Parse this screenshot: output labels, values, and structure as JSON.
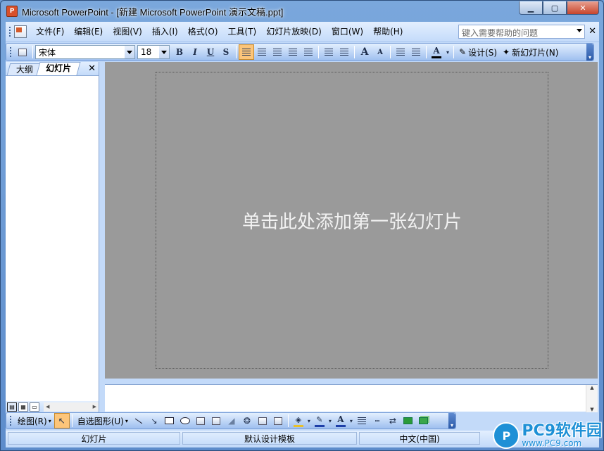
{
  "window": {
    "title": "Microsoft PowerPoint - [新建 Microsoft PowerPoint 演示文稿.ppt]",
    "app_icon_letter": "P",
    "min_glyph": "▁",
    "max_glyph": "▢",
    "close_glyph": "✕"
  },
  "menubar": {
    "items": [
      "文件(F)",
      "编辑(E)",
      "视图(V)",
      "插入(I)",
      "格式(O)",
      "工具(T)",
      "幻灯片放映(D)",
      "窗口(W)",
      "帮助(H)"
    ],
    "help_placeholder": "键入需要帮助的问题",
    "close_doc_glyph": "✕"
  },
  "format_toolbar": {
    "font": "宋体",
    "size": "18",
    "bold": "B",
    "italic": "I",
    "underline": "U",
    "shadow": "S",
    "grow_font": "A",
    "shrink_font": "A",
    "font_color": "A",
    "design_label": "设计(S)",
    "new_slide_label": "新幻灯片(N)",
    "colors": {
      "active_bg": "#fcc57a",
      "font_color_bar": "#000000"
    }
  },
  "left_pane": {
    "tabs": [
      "大纲",
      "幻灯片"
    ],
    "active_tab": "幻灯片",
    "close_glyph": "✕"
  },
  "slide": {
    "placeholder": "单击此处添加第一张幻灯片",
    "background": "#9a9a9a"
  },
  "draw_toolbar": {
    "draw_label": "绘图(R)",
    "autoshapes_label": "自选图形(U)",
    "line_color": "#1e3fa8",
    "fill_color": "#e8c02a",
    "font_color": "#1e3fa8"
  },
  "statusbar": {
    "slide": "幻灯片",
    "template": "默认设计模板",
    "language": "中文(中国)"
  },
  "watermark": {
    "badge": "P",
    "title": "PC9软件园",
    "url": "www.PC9.com"
  }
}
